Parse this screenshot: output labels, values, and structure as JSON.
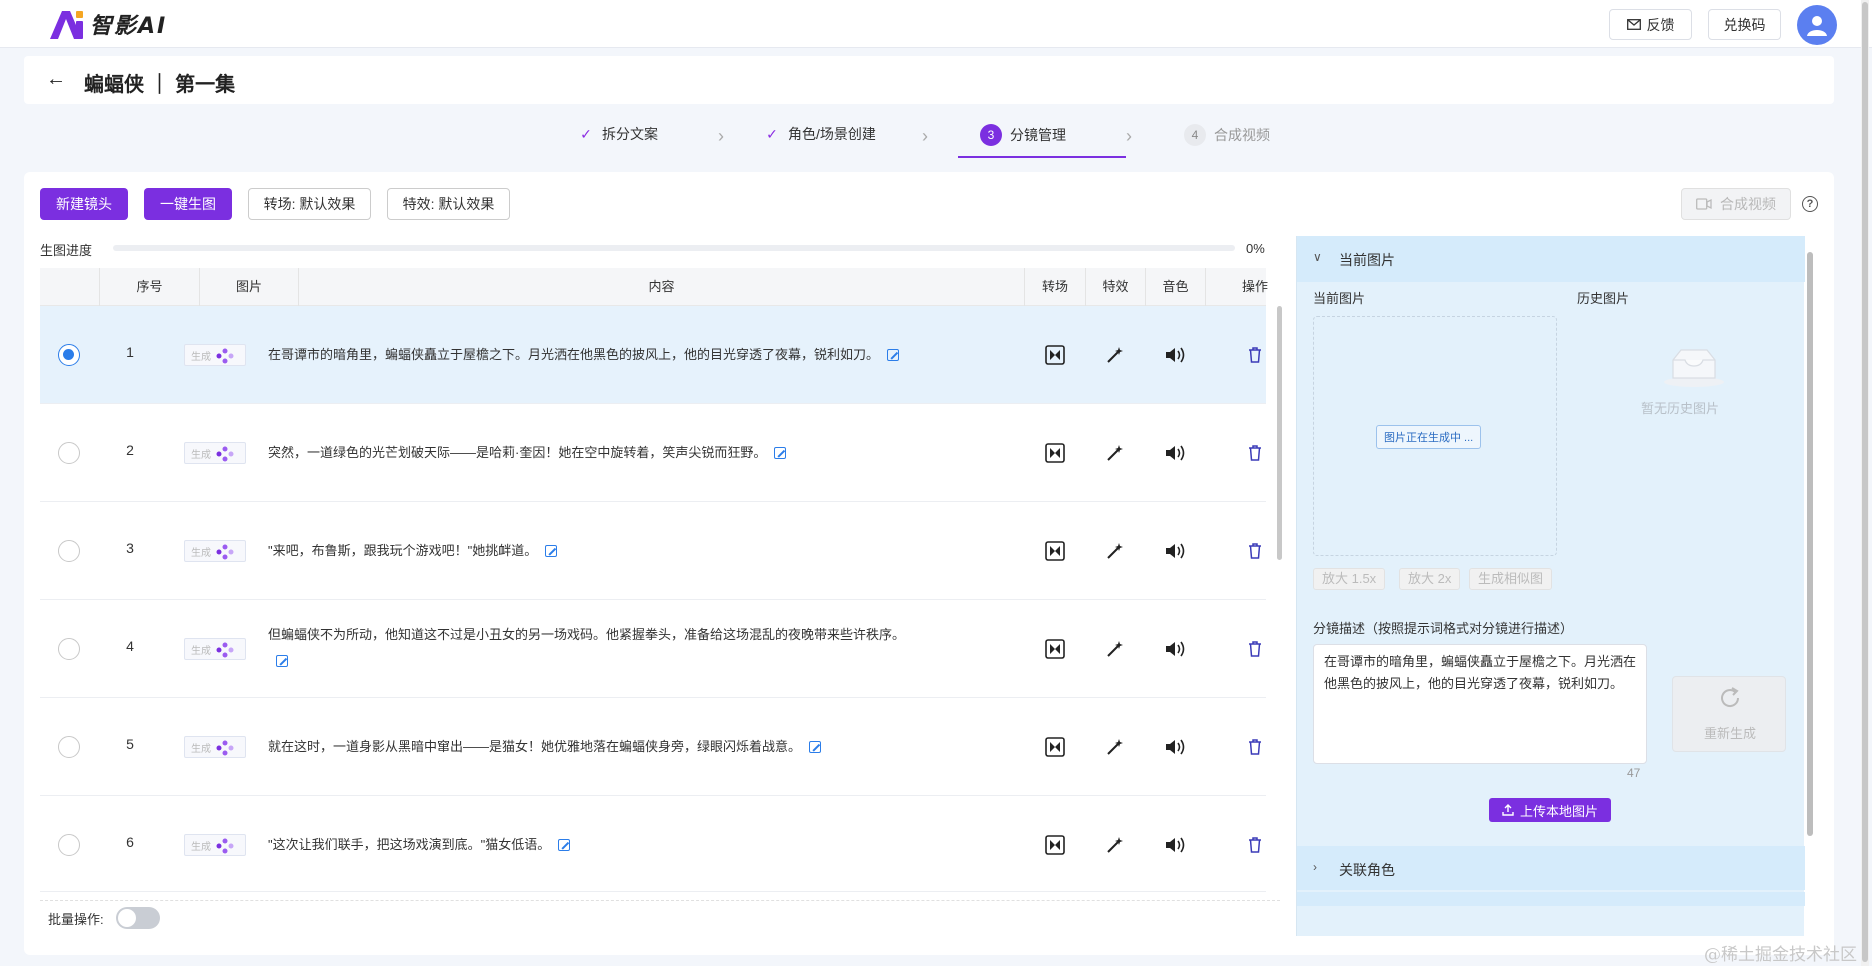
{
  "app": {
    "brand": "智影AI"
  },
  "topbar": {
    "feedback_label": "反馈",
    "redeem_label": "兑换码"
  },
  "header": {
    "title": "蝙蝠侠 ｜ 第一集"
  },
  "steps": [
    {
      "label": "拆分文案",
      "state": "done"
    },
    {
      "label": "角色/场景创建",
      "state": "done"
    },
    {
      "num": "3",
      "label": "分镜管理",
      "state": "active"
    },
    {
      "num": "4",
      "label": "合成视频",
      "state": "pending"
    }
  ],
  "toolbar": {
    "new_shot": "新建镜头",
    "one_click": "一键生图",
    "transition": "转场: 默认效果",
    "effect": "特效: 默认效果",
    "compose": "合成视频"
  },
  "progress": {
    "label": "生图进度",
    "percent": "0%",
    "value": 0
  },
  "table": {
    "headers": {
      "seq": "序号",
      "image": "图片",
      "content": "内容",
      "transition": "转场",
      "effect": "特效",
      "voice": "音色",
      "action": "操作"
    },
    "thumb_placeholder": "生成",
    "rows": [
      {
        "seq": "1",
        "content": "在哥谭市的暗角里，蝙蝠侠矗立于屋檐之下。月光洒在他黑色的披风上，他的目光穿透了夜幕，锐利如刀。",
        "selected": true
      },
      {
        "seq": "2",
        "content": "突然，一道绿色的光芒划破天际——是哈莉·奎因！她在空中旋转着，笑声尖锐而狂野。",
        "selected": false
      },
      {
        "seq": "3",
        "content": "\"来吧，布鲁斯，跟我玩个游戏吧！\"她挑衅道。",
        "selected": false
      },
      {
        "seq": "4",
        "content": "但蝙蝠侠不为所动，他知道这不过是小丑女的另一场戏码。他紧握拳头，准备给这场混乱的夜晚带来些许秩序。",
        "selected": false
      },
      {
        "seq": "5",
        "content": "就在这时，一道身影从黑暗中窜出——是猫女！她优雅地落在蝙蝠侠身旁，绿眼闪烁着战意。",
        "selected": false
      },
      {
        "seq": "6",
        "content": "\"这次让我们联手，把这场戏演到底。\"猫女低语。",
        "selected": false
      }
    ]
  },
  "batch": {
    "label": "批量操作:"
  },
  "side": {
    "section_title": "当前图片",
    "current_label": "当前图片",
    "history_label": "历史图片",
    "generating": "图片正在生成中 ...",
    "no_history": "暂无历史图片",
    "zoom15": "放大 1.5x",
    "zoom2": "放大 2x",
    "similar": "生成相似图",
    "desc_label": "分镜描述（按照提示词格式对分镜进行描述）",
    "desc_value": "在哥谭市的暗角里，蝙蝠侠矗立于屋檐之下。月光洒在他黑色的披风上，他的目光穿透了夜幕，锐利如刀。",
    "char_count": "47",
    "regen": "重新生成",
    "upload": "上传本地图片",
    "related_roles": "关联角色"
  },
  "watermark": "@稀土掘金技术社区",
  "colors": {
    "accent": "#7b2fe0",
    "selected_row": "#e6f2fc",
    "side_bg": "#e3f1fb",
    "radio_on": "#2b7de9"
  }
}
